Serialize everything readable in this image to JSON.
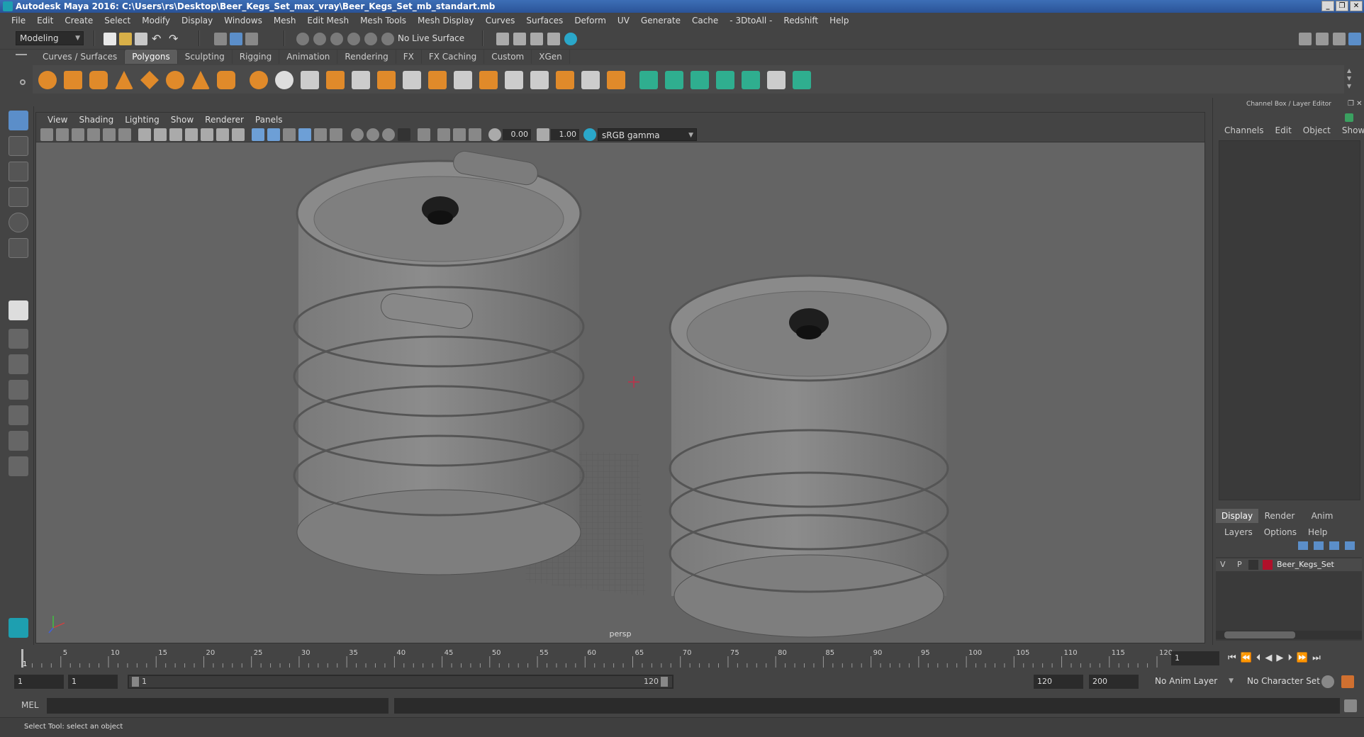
{
  "window": {
    "title": "Autodesk Maya 2016: C:\\Users\\rs\\Desktop\\Beer_Kegs_Set_max_vray\\Beer_Kegs_Set_mb_standart.mb",
    "minimize": "0",
    "restore": "2",
    "close": "r"
  },
  "menubar": [
    "File",
    "Edit",
    "Create",
    "Select",
    "Modify",
    "Display",
    "Windows",
    "Mesh",
    "Edit Mesh",
    "Mesh Tools",
    "Mesh Display",
    "Curves",
    "Surfaces",
    "Deform",
    "UV",
    "Generate",
    "Cache",
    "- 3DtoAll -",
    "Redshift",
    "Help"
  ],
  "statusline": {
    "mode": "Modeling",
    "live_surface": "No Live Surface"
  },
  "shelf": {
    "tabs": [
      "Curves / Surfaces",
      "Polygons",
      "Sculpting",
      "Rigging",
      "Animation",
      "Rendering",
      "FX",
      "FX Caching",
      "Custom",
      "XGen"
    ],
    "active_tab": "Polygons"
  },
  "viewport": {
    "menu": [
      "View",
      "Shading",
      "Lighting",
      "Show",
      "Renderer",
      "Panels"
    ],
    "exposure": "0.00",
    "gamma": "1.00",
    "color_space": "sRGB gamma",
    "camera": "persp"
  },
  "channel_box": {
    "title": "Channel Box / Layer Editor",
    "menu": [
      "Channels",
      "Edit",
      "Object",
      "Show"
    ]
  },
  "layer_editor": {
    "tabs": [
      "Display",
      "Render",
      "Anim"
    ],
    "active_tab": "Display",
    "menu": [
      "Layers",
      "Options",
      "Help"
    ],
    "layers": [
      {
        "visible": "V",
        "playback": "P",
        "name": "Beer_Kegs_Set",
        "color": "#b0102a"
      }
    ]
  },
  "timeline": {
    "ticks": [
      "5",
      "10",
      "15",
      "20",
      "25",
      "30",
      "35",
      "40",
      "45",
      "50",
      "55",
      "60",
      "65",
      "70",
      "75",
      "80",
      "85",
      "90",
      "95",
      "100",
      "105",
      "110",
      "115",
      "120"
    ],
    "current_frame_marker": "1",
    "current_frame": "1"
  },
  "range": {
    "start": "1",
    "anim_start": "1",
    "slider_start": "1",
    "slider_end": "120",
    "anim_end": "120",
    "end": "200",
    "anim_layer": "No Anim Layer",
    "character_set": "No Character Set"
  },
  "command": {
    "language": "MEL"
  },
  "help": {
    "text": "Select Tool: select an object"
  }
}
